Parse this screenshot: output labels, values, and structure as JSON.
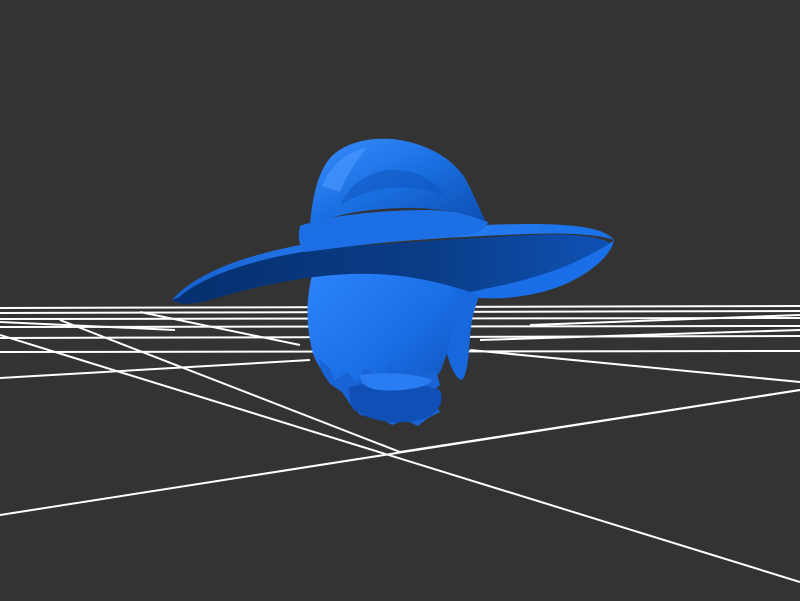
{
  "viewer": {
    "background_color": "#333333",
    "grid_color": "#ffffff",
    "model_color": "#1a73e8",
    "model_shadow_color": "#0b3f96",
    "model_highlight_color": "#4a9bff",
    "model_subject": "head-with-wide-brim-hat"
  }
}
